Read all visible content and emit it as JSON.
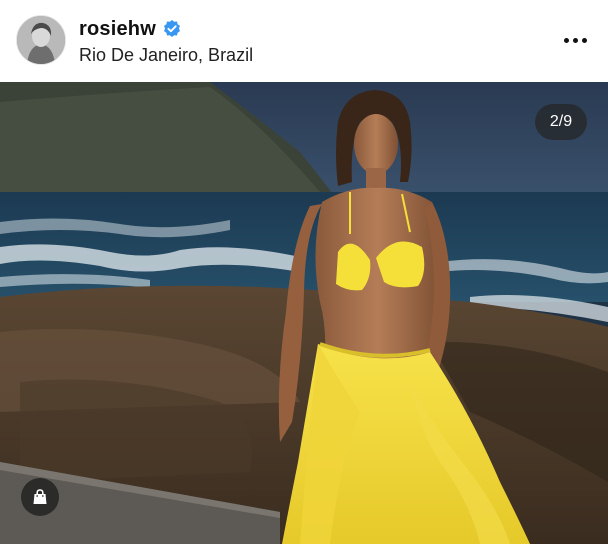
{
  "post": {
    "username": "rosiehw",
    "verified": true,
    "location": "Rio De Janeiro, Brazil",
    "more_icon": "more-horizontal-icon",
    "carousel_counter": "2/9",
    "shop_icon": "shopping-bag-icon"
  },
  "colors": {
    "verified_badge": "#3897f0",
    "swimwear": "#f5e03a",
    "counter_bg": "#262626"
  }
}
